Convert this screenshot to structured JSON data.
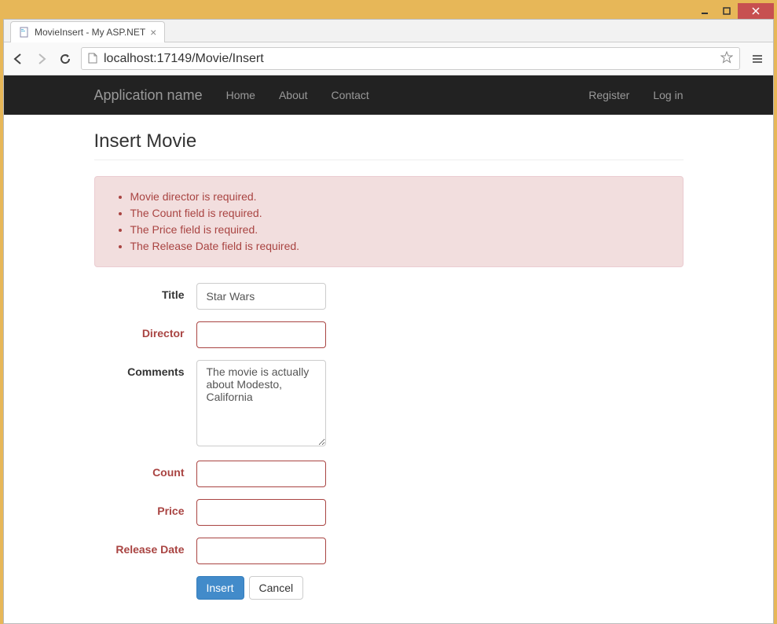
{
  "window": {
    "tab_title": "MovieInsert - My ASP.NET"
  },
  "browser": {
    "url_display": "localhost:17149/Movie/Insert"
  },
  "navbar": {
    "brand": "Application name",
    "links": [
      "Home",
      "About",
      "Contact"
    ],
    "right_links": [
      "Register",
      "Log in"
    ]
  },
  "page": {
    "heading": "Insert Movie"
  },
  "validation": {
    "errors": [
      "Movie director is required.",
      "The Count field is required.",
      "The Price field is required.",
      "The Release Date field is required."
    ]
  },
  "form": {
    "fields": {
      "title": {
        "label": "Title",
        "value": "Star Wars",
        "error": false
      },
      "director": {
        "label": "Director",
        "value": "",
        "error": true
      },
      "comments": {
        "label": "Comments",
        "value": "The movie is actually about Modesto, California",
        "error": false
      },
      "count": {
        "label": "Count",
        "value": "",
        "error": true
      },
      "price": {
        "label": "Price",
        "value": "",
        "error": true
      },
      "release_date": {
        "label": "Release Date",
        "value": "",
        "error": true
      }
    },
    "buttons": {
      "submit": "Insert",
      "cancel": "Cancel"
    }
  }
}
